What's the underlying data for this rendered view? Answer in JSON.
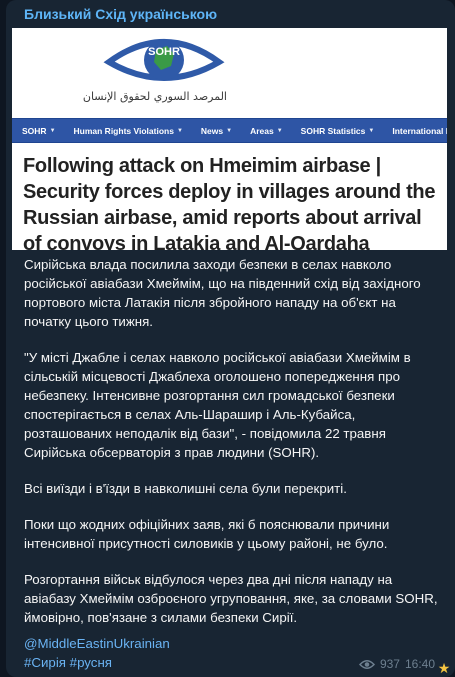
{
  "channel": {
    "name": "Близький Схід українською"
  },
  "media": {
    "logo_text": "SOHR",
    "logo_arabic": "المرصد السوري لحقوق الإنسان",
    "nav": [
      {
        "label": "SOHR",
        "dropdown": true
      },
      {
        "label": "Human Rights Violations",
        "dropdown": true
      },
      {
        "label": "News",
        "dropdown": true
      },
      {
        "label": "Areas",
        "dropdown": true
      },
      {
        "label": "SOHR Statistics",
        "dropdown": true
      },
      {
        "label": "International Powers",
        "dropdown": false
      }
    ],
    "headline": "Following attack on Hmeimim airbase | Security forces deploy in villages around the Russian airbase, amid reports about arrival of convoys in Latakia and Al-Qardaha",
    "colors": {
      "nav_bg": "#2e55a5",
      "logo_blue": "#2f5aa8",
      "logo_green": "#3a9a46"
    }
  },
  "body": {
    "paragraphs": [
      "Сирійська влада посилила заходи безпеки в селах навколо російської авіабази Хмеймім, що на південний схід від західного портового міста Латакія після збройного нападу на об'єкт на початку цього тижня.",
      "\"У місті Джабле і селах навколо російської авіабази Хмеймім в сільській місцевості Джаблеха оголошено попередження про небезпеку. Інтенсивне розгортання сил громадської безпеки спостерігається в селах Аль-Шарашир і Аль-Кубайса, розташованих неподалік від бази\", - повідомила 22 травня Сирійська обсерваторія з прав людини (SOHR).",
      "Всі виїзди і в'їзди в навколишні села були перекриті.",
      "Поки що жодних офіційних заяв, які б пояснювали причини інтенсивної присутності силовиків у цьому районі, не було.",
      "Розгортання військ відбулося через два дні після нападу на авіабазу Хмеймім озброєного угруповання, яке, за словами SOHR, ймовірно, пов'язане з силами безпеки Сирії."
    ],
    "channel_link": "@MiddleEastinUkrainian",
    "hashtags": "#Сирія #русня"
  },
  "meta": {
    "views": "937",
    "time": "16:40",
    "views_icon": "eye-icon",
    "reaction_icon": "star-icon"
  }
}
